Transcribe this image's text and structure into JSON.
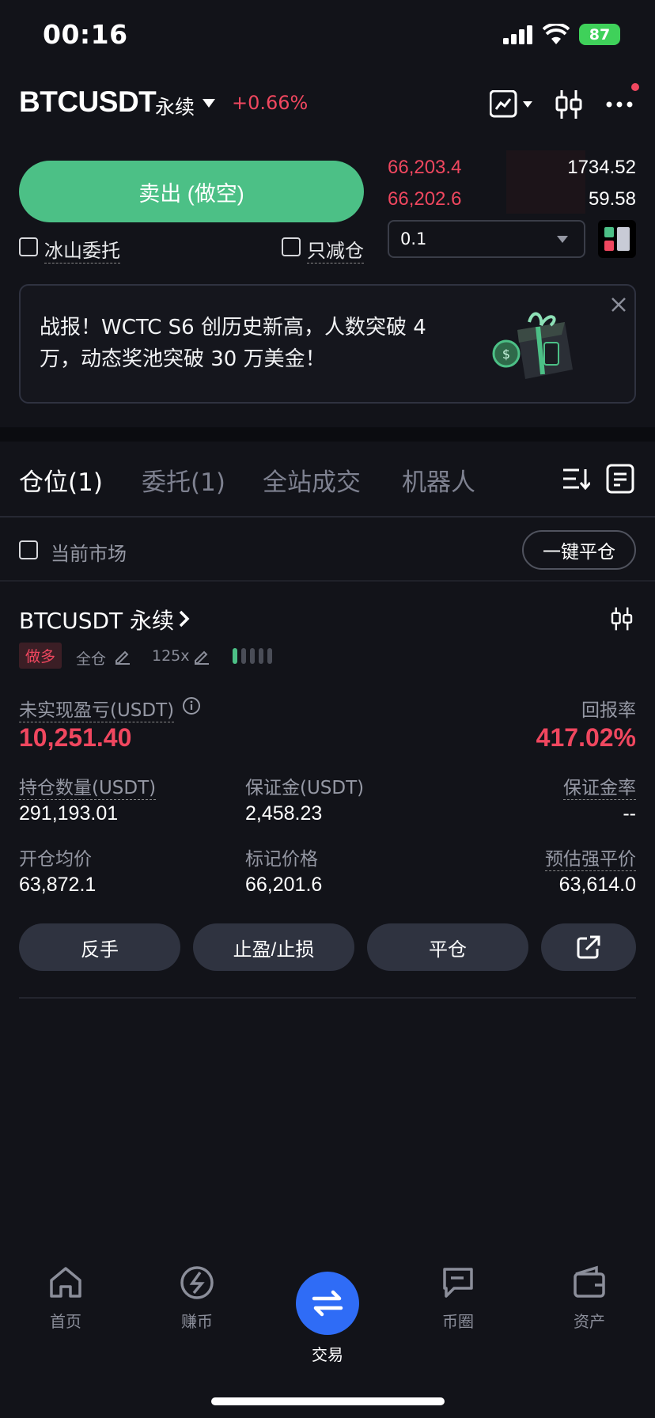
{
  "status_bar": {
    "time": "00:16",
    "battery": "87"
  },
  "header": {
    "symbol": "BTCUSDT",
    "contract": "永续",
    "change": "+0.66%"
  },
  "order_book": {
    "asks": [
      {
        "price": "66,203.4",
        "qty": "1734.52"
      },
      {
        "price": "66,202.6",
        "qty": "59.58"
      }
    ],
    "quantity_select": "0.1"
  },
  "order_form": {
    "sell_label": "卖出 (做空)",
    "iceberg_label": "冰山委托",
    "reduce_only_label": "只减仓"
  },
  "banner": {
    "text": "战报！WCTC S6 创历史新高，人数突破 4 万，动态奖池突破 30 万美金！"
  },
  "tabs": [
    {
      "label": "仓位(1)"
    },
    {
      "label": "委托(1)"
    },
    {
      "label": "全站成交"
    },
    {
      "label": "机器人"
    }
  ],
  "filter": {
    "current_market_label": "当前市场",
    "close_all_label": "一键平仓"
  },
  "position": {
    "symbol": "BTCUSDT 永续",
    "side": "做多",
    "margin_mode": "全仓",
    "leverage": "125x",
    "risk_level": 1,
    "risk_total": 5,
    "unrealized_pnl_label": "未实现盈亏(USDT)",
    "unrealized_pnl": "10,251.40",
    "roe_label": "回报率",
    "roe": "417.02%",
    "size_label": "持仓数量(USDT)",
    "size": "291,193.01",
    "margin_label": "保证金(USDT)",
    "margin": "2,458.23",
    "margin_ratio_label": "保证金率",
    "margin_ratio": "--",
    "entry_label": "开仓均价",
    "entry": "63,872.1",
    "mark_label": "标记价格",
    "mark": "66,201.6",
    "liq_label": "预估强平价",
    "liq": "63,614.0",
    "actions": {
      "reverse": "反手",
      "tpsl": "止盈/止损",
      "close": "平仓"
    }
  },
  "bottom_nav": [
    {
      "label": "首页"
    },
    {
      "label": "赚币"
    },
    {
      "label": "交易"
    },
    {
      "label": "币圈"
    },
    {
      "label": "资产"
    }
  ],
  "colors": {
    "accent_green": "#4cc086",
    "accent_red": "#f0475f",
    "nav_active": "#2f6cf6",
    "background": "#121319"
  }
}
